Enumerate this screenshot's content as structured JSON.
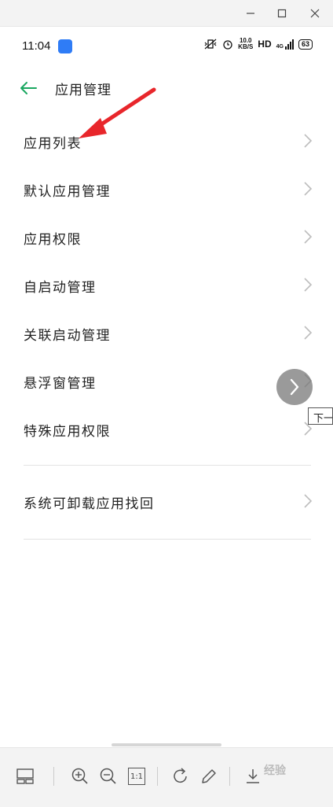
{
  "status_bar": {
    "time": "11:04",
    "speed_value": "10.0",
    "speed_unit": "KB/S",
    "hd": "HD",
    "network": "4G",
    "battery": "63"
  },
  "header": {
    "title": "应用管理"
  },
  "settings": {
    "items": [
      {
        "label": "应用列表"
      },
      {
        "label": "默认应用管理"
      },
      {
        "label": "应用权限"
      },
      {
        "label": "自启动管理"
      },
      {
        "label": "关联启动管理"
      },
      {
        "label": "悬浮窗管理"
      },
      {
        "label": "特殊应用权限"
      }
    ],
    "extra_item": {
      "label": "系统可卸载应用找回"
    }
  },
  "overlay": {
    "tooltip": "下一"
  },
  "toolbar": {
    "zoom_reset_label": "1:1",
    "watermark": "经验"
  },
  "colors": {
    "accent": "#1aa760",
    "annotation": "#e8262b"
  }
}
